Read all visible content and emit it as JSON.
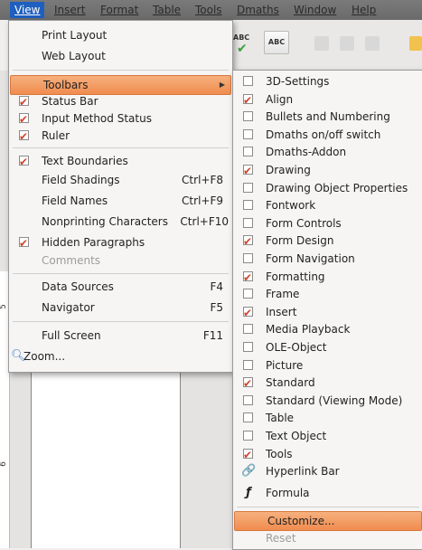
{
  "menubar": {
    "items": [
      "View",
      "Insert",
      "Format",
      "Table",
      "Tools",
      "Dmaths",
      "Window",
      "Help"
    ]
  },
  "toolbar": {
    "spellcheck_label": "ABC",
    "autospell_label": "ABC"
  },
  "ruler": {
    "numbers": [
      "5",
      "6"
    ]
  },
  "view_menu": {
    "items": [
      {
        "label": "Print Layout",
        "checked": false
      },
      {
        "label": "Web Layout",
        "checked": false
      },
      {
        "label": "Toolbars",
        "submenu": true
      },
      {
        "label": "Status Bar",
        "checked": true
      },
      {
        "label": "Input Method Status",
        "checked": true
      },
      {
        "label": "Ruler",
        "checked": true
      },
      {
        "label": "Text Boundaries",
        "checked": true
      },
      {
        "label": "Field Shadings",
        "shortcut": "Ctrl+F8"
      },
      {
        "label": "Field Names",
        "shortcut": "Ctrl+F9"
      },
      {
        "label": "Nonprinting Characters",
        "shortcut": "Ctrl+F10"
      },
      {
        "label": "Hidden Paragraphs",
        "checked": true
      },
      {
        "label": "Comments",
        "disabled": true
      },
      {
        "label": "Data Sources",
        "shortcut": "F4"
      },
      {
        "label": "Navigator",
        "shortcut": "F5"
      },
      {
        "label": "Full Screen",
        "shortcut": "F11"
      },
      {
        "label": "Zoom...",
        "icon": "magnifier-icon"
      }
    ]
  },
  "toolbars_submenu": {
    "items": [
      {
        "label": "3D-Settings",
        "checked": false
      },
      {
        "label": "Align",
        "checked": true
      },
      {
        "label": "Bullets and Numbering",
        "checked": false
      },
      {
        "label": "Dmaths on/off switch",
        "checked": false
      },
      {
        "label": "Dmaths-Addon",
        "checked": false
      },
      {
        "label": "Drawing",
        "checked": true
      },
      {
        "label": "Drawing Object Properties",
        "checked": false
      },
      {
        "label": "Fontwork",
        "checked": false
      },
      {
        "label": "Form Controls",
        "checked": false
      },
      {
        "label": "Form Design",
        "checked": true
      },
      {
        "label": "Form Navigation",
        "checked": false
      },
      {
        "label": "Formatting",
        "checked": true
      },
      {
        "label": "Frame",
        "checked": false
      },
      {
        "label": "Insert",
        "checked": true
      },
      {
        "label": "Media Playback",
        "checked": false
      },
      {
        "label": "OLE-Object",
        "checked": false
      },
      {
        "label": "Picture",
        "checked": false
      },
      {
        "label": "Standard",
        "checked": true
      },
      {
        "label": "Standard (Viewing Mode)",
        "checked": false
      },
      {
        "label": "Table",
        "checked": false
      },
      {
        "label": "Text Object",
        "checked": false
      },
      {
        "label": "Tools",
        "checked": true
      },
      {
        "label": "Hyperlink Bar",
        "icon": "hyperlink-icon"
      },
      {
        "label": "Formula",
        "icon": "formula-icon"
      },
      {
        "label": "Customize..."
      },
      {
        "label": "Reset",
        "disabled": true
      }
    ]
  }
}
